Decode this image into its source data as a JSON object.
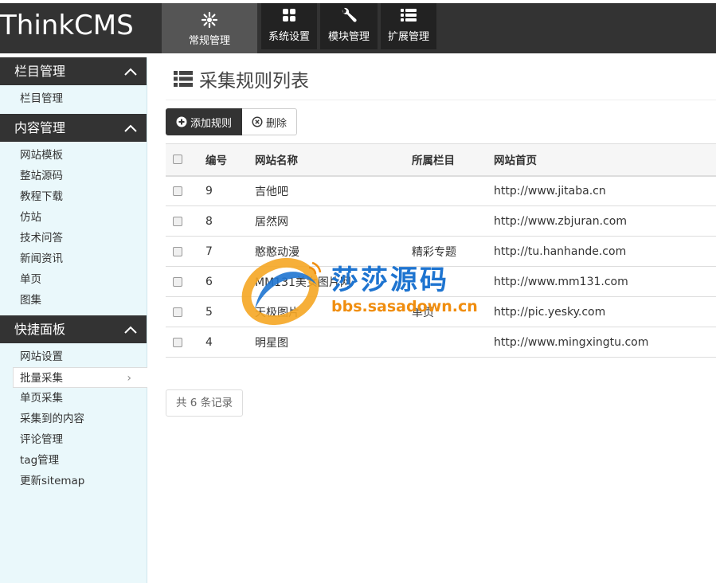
{
  "brand": "ThinkCMS",
  "nav": [
    {
      "label": "常规管理",
      "icon": "gear-flower-icon",
      "active": true
    },
    {
      "label": "系统设置",
      "icon": "grid-icon"
    },
    {
      "label": "模块管理",
      "icon": "wrench-icon"
    },
    {
      "label": "扩展管理",
      "icon": "list-icon"
    }
  ],
  "sidebar": {
    "sections": [
      {
        "title": "栏目管理",
        "items": [
          "栏目管理"
        ]
      },
      {
        "title": "内容管理",
        "items": [
          "网站模板",
          "整站源码",
          "教程下载",
          "仿站",
          "技术问答",
          "新闻资讯",
          "单页",
          "图集"
        ]
      },
      {
        "title": "快捷面板",
        "items": [
          "网站设置",
          "批量采集",
          "单页采集",
          "采集到的内容",
          "评论管理",
          "tag管理",
          "更新sitemap"
        ]
      }
    ],
    "active_item": "批量采集"
  },
  "page_title": "采集规则列表",
  "toolbar": {
    "add_label": "添加规则",
    "delete_label": "删除"
  },
  "table": {
    "headers": [
      "编号",
      "网站名称",
      "所属栏目",
      "网站首页"
    ],
    "rows": [
      {
        "id": "9",
        "name": "吉他吧",
        "category": "",
        "url": "http://www.jitaba.cn"
      },
      {
        "id": "8",
        "name": "居然网",
        "category": "",
        "url": "http://www.zbjuran.com"
      },
      {
        "id": "7",
        "name": "憨憨动漫",
        "category": "精彩专题",
        "url": "http://tu.hanhande.com"
      },
      {
        "id": "6",
        "name": "MM131美女图片网",
        "category": "",
        "url": "http://www.mm131.com"
      },
      {
        "id": "5",
        "name": "天极图片",
        "category": "单页",
        "url": "http://pic.yesky.com"
      },
      {
        "id": "4",
        "name": "明星图",
        "category": "",
        "url": "http://www.mingxingtu.com"
      }
    ]
  },
  "footer": "共 6 条记录",
  "watermark": {
    "title": "莎莎源码",
    "url": "bbs.sasadown.cn"
  },
  "colors": {
    "topbar": "#333333",
    "sidebar_bg": "#eaf8fb",
    "watermark_blue": "#1e74d0",
    "watermark_orange": "#f08e10"
  }
}
